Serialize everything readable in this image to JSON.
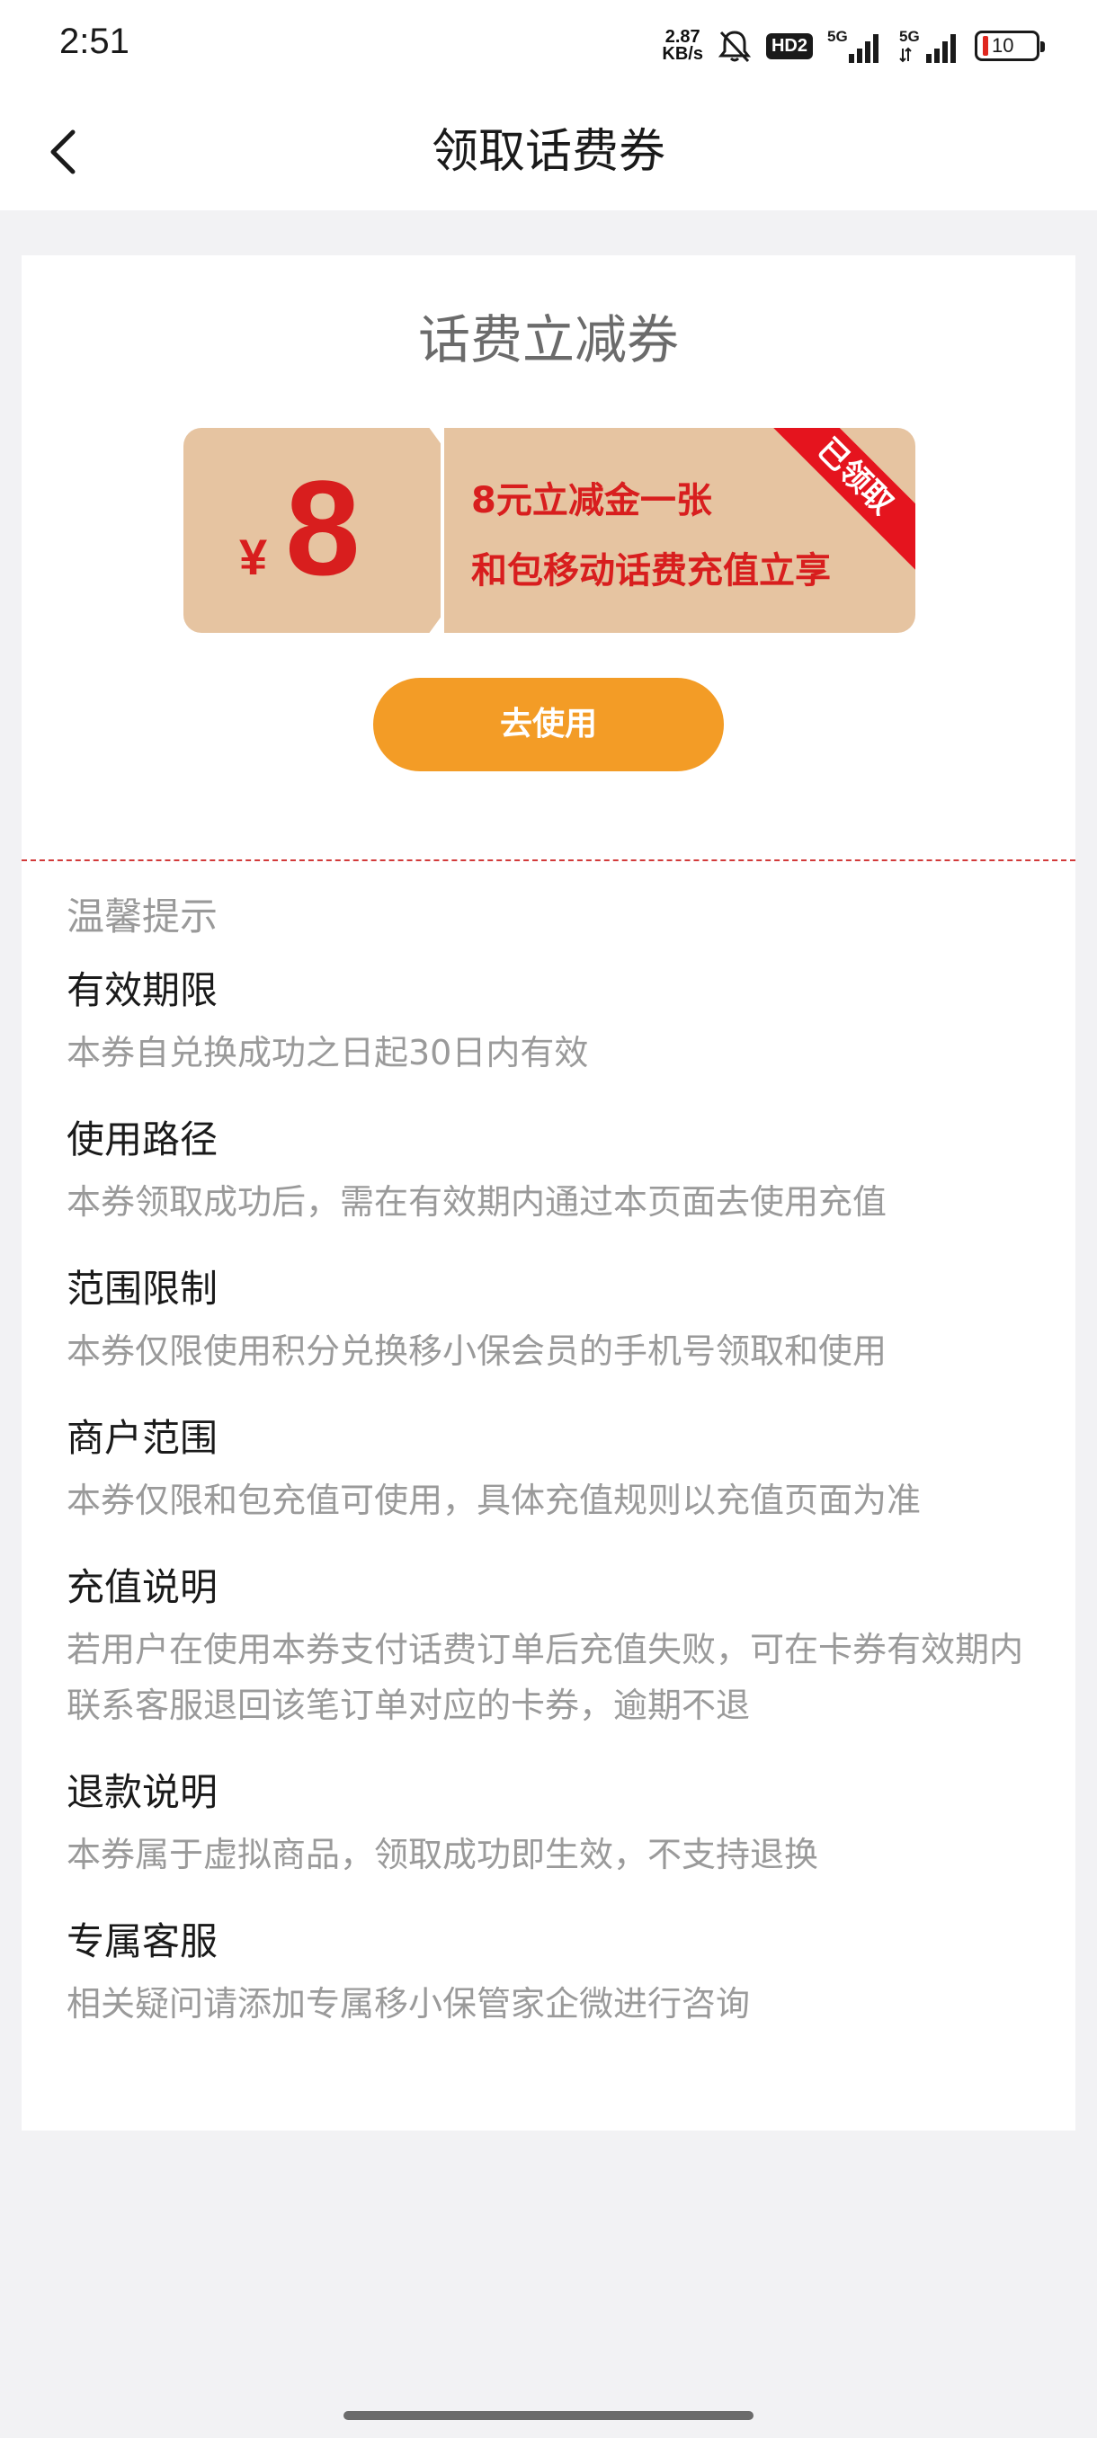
{
  "status_bar": {
    "time": "2:51",
    "net_speed_value": "2.87",
    "net_speed_unit": "KB/s",
    "hd_label": "HD2",
    "signal1_label": "5G",
    "signal2_label": "5G",
    "battery_level": "10"
  },
  "nav": {
    "title": "领取话费券"
  },
  "card": {
    "title": "话费立减券",
    "coupon": {
      "currency": "¥",
      "amount": "8",
      "line1": "8元立减金一张",
      "line2": "和包移动话费充值立享",
      "ribbon": "已领取"
    },
    "use_button": "去使用"
  },
  "tips": {
    "title": "温馨提示",
    "items": [
      {
        "heading": "有效期限",
        "text": "本券自兑换成功之日起30日内有效"
      },
      {
        "heading": "使用路径",
        "text": "本券领取成功后，需在有效期内通过本页面去使用充值"
      },
      {
        "heading": "范围限制",
        "text": "本券仅限使用积分兑换移小保会员的手机号领取和使用"
      },
      {
        "heading": "商户范围",
        "text": "本券仅限和包充值可使用，具体充值规则以充值页面为准"
      },
      {
        "heading": "充值说明",
        "text": "若用户在使用本券支付话费订单后充值失败，可在卡券有效期内联系客服退回该笔订单对应的卡券，逾期不退"
      },
      {
        "heading": "退款说明",
        "text": "本券属于虚拟商品，领取成功即生效，不支持退换"
      },
      {
        "heading": "专属客服",
        "text": "相关疑问请添加专属移小保管家企微进行咨询"
      }
    ]
  },
  "colors": {
    "accent": "#f39c26",
    "coupon_bg": "#e6c4a1",
    "coupon_text": "#d81e1e",
    "ribbon": "#e5141e"
  }
}
